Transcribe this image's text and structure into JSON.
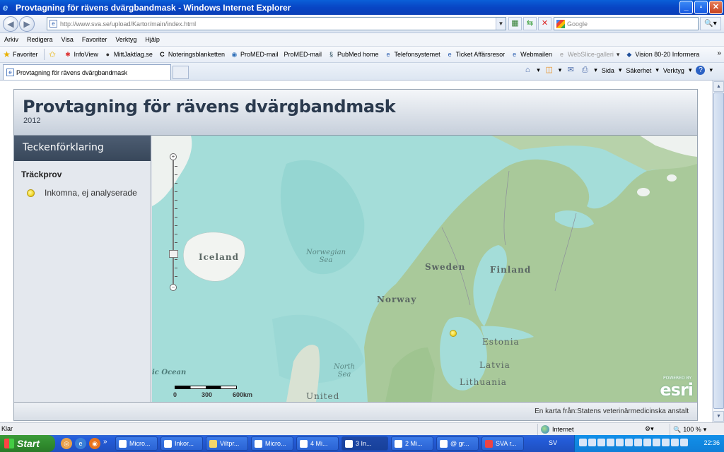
{
  "window": {
    "title": "Provtagning för rävens dvärgbandmask - Windows Internet Explorer"
  },
  "addressbar": {
    "url": "http://www.sva.se/upload/Kartor/main/index.html",
    "search_placeholder": "Google"
  },
  "menu": [
    "Arkiv",
    "Redigera",
    "Visa",
    "Favoriter",
    "Verktyg",
    "Hjälp"
  ],
  "favorites": {
    "label": "Favoriter",
    "items": [
      "InfoView",
      "MittJaktlag.se",
      "Noteringsblanketten",
      "ProMED-mail",
      "ProMED-mail",
      "PubMed home",
      "Telefonsystemet",
      "Ticket Affärsresor",
      "Webmailen",
      "WebSlice-galleri",
      "Vision 80-20 Informera"
    ]
  },
  "tabs": {
    "active": "Provtagning för rävens dvärgbandmask"
  },
  "commandbar": {
    "page": "Sida",
    "safety": "Säkerhet",
    "tools": "Verktyg"
  },
  "app": {
    "title": "Provtagning för rävens dvärgbandmask",
    "year": "2012",
    "legend": {
      "header": "Teckenförklaring",
      "group": "Träckprov",
      "item": "Inkomna, ej analyserade"
    },
    "footer": "En karta från:Statens veterinärmedicinska anstalt"
  },
  "map": {
    "labels": {
      "iceland": "Iceland",
      "norwegian_sea_1": "Norwegian",
      "norwegian_sea_2": "Sea",
      "sweden": "Sweden",
      "finland": "Finland",
      "norway": "Norway",
      "estonia": "Estonia",
      "latvia": "Latvia",
      "lithuania": "Lithuania",
      "north_sea_1": "North",
      "north_sea_2": "Sea",
      "ocean": "ic Ocean",
      "united": "United"
    },
    "scale": [
      "0",
      "300",
      "600km"
    ],
    "attribution": "esri",
    "attribution_small": "POWERED BY"
  },
  "statusbar": {
    "status": "Klar",
    "zone": "Internet",
    "zoom": "100 %"
  },
  "taskbar": {
    "start": "Start",
    "tasks": [
      "Micro...",
      "Inkor...",
      "Viltpr...",
      "Micro...",
      "4 Mi...",
      "3 In...",
      "2 Mi...",
      "@ gr...",
      "SVA r..."
    ],
    "lang": "SV",
    "clock": "22:36"
  },
  "colors": {
    "sea": "#a4ddd9",
    "land": "#a9c99a",
    "marker": "#f1d72c"
  }
}
